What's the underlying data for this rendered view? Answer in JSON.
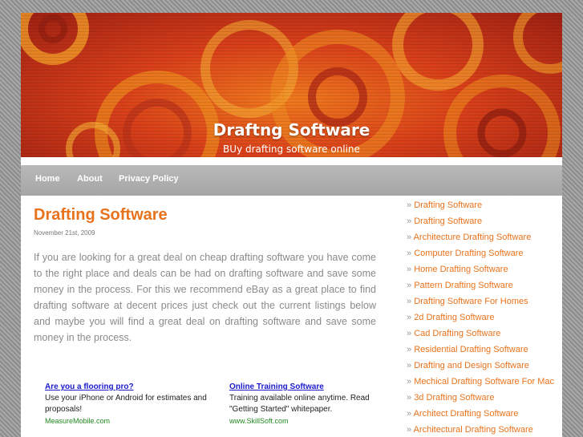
{
  "site": {
    "title": "Draftng Software",
    "tagline": "BUy drafting software online"
  },
  "nav": {
    "items": [
      {
        "label": "Home"
      },
      {
        "label": "About"
      },
      {
        "label": "Privacy Policy"
      }
    ]
  },
  "post": {
    "title": "Drafting Software",
    "date": "November 21st, 2009",
    "body": "If you are looking for a great deal on cheap  drafting software  you have come to the right place and deals can be had on  drafting software and save some money in the process. For this we recommend eBay as a great place to find  drafting software at decent prices just check out the current listings below and maybe you will find a great deal on drafting software  and save some money in the process."
  },
  "ads": [
    {
      "title": "Are you a flooring pro?",
      "text": "Use your iPhone or Android for estimates and proposals!",
      "url": "MeasureMobile.com"
    },
    {
      "title": "Online Training Software",
      "text": "Training available online anytime. Read \"Getting Started\" whitepaper.",
      "url": "www.SkillSoft.com"
    }
  ],
  "sidebar": {
    "bullet": "»",
    "links": [
      "Drafting Software",
      "Drafting Software",
      "Architecture Drafting Software",
      "Computer Drafting Software",
      "Home Drafting Software",
      "Pattern Drafting Software",
      "Drafting Software For Homes",
      "2d Drafting Software",
      "Cad Drafting Software",
      "Residential Drafting Software",
      "Drafting and Design Software",
      "Mechical Drafting Software For Mac",
      "3d Drafting Software",
      "Architect Drafting Software",
      "Architectural Drafting Software"
    ]
  },
  "colors": {
    "accent": "#e8721c",
    "nav_bg": "#b0b0b0",
    "ad_link": "#1a1acc",
    "ad_url": "#228822",
    "body_text": "#8a8a8a"
  }
}
